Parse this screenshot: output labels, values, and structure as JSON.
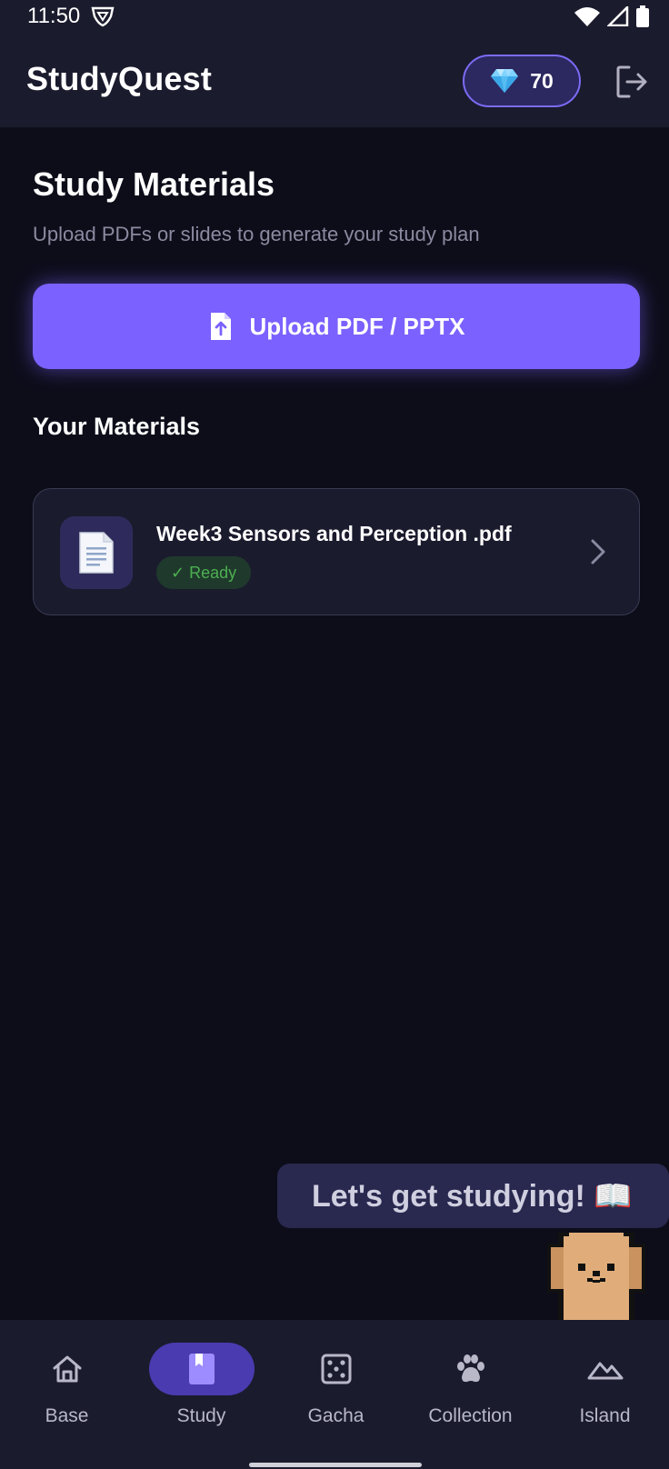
{
  "status_bar": {
    "time": "11:50"
  },
  "app_bar": {
    "title": "StudyQuest",
    "gem_count": "70"
  },
  "page": {
    "title": "Study Materials",
    "subtitle": "Upload PDFs or slides to generate your study plan",
    "upload_label": "Upload PDF / PPTX",
    "section_title": "Your Materials"
  },
  "materials": [
    {
      "name": "Week3 Sensors and Perception .pdf",
      "status": "✓ Ready",
      "icon": "document-icon"
    }
  ],
  "mascot": {
    "speech": "Let's get studying! 📖"
  },
  "nav": {
    "items": [
      {
        "label": "Base",
        "icon": "home-icon"
      },
      {
        "label": "Study",
        "icon": "bookmark-book-icon",
        "active": true
      },
      {
        "label": "Gacha",
        "icon": "dice-icon"
      },
      {
        "label": "Collection",
        "icon": "paw-icon"
      },
      {
        "label": "Island",
        "icon": "mountain-icon"
      }
    ]
  },
  "colors": {
    "accent": "#7b61ff",
    "background": "#0d0d1a",
    "surface": "#1b1b2e",
    "ready_green": "#4caf50"
  }
}
